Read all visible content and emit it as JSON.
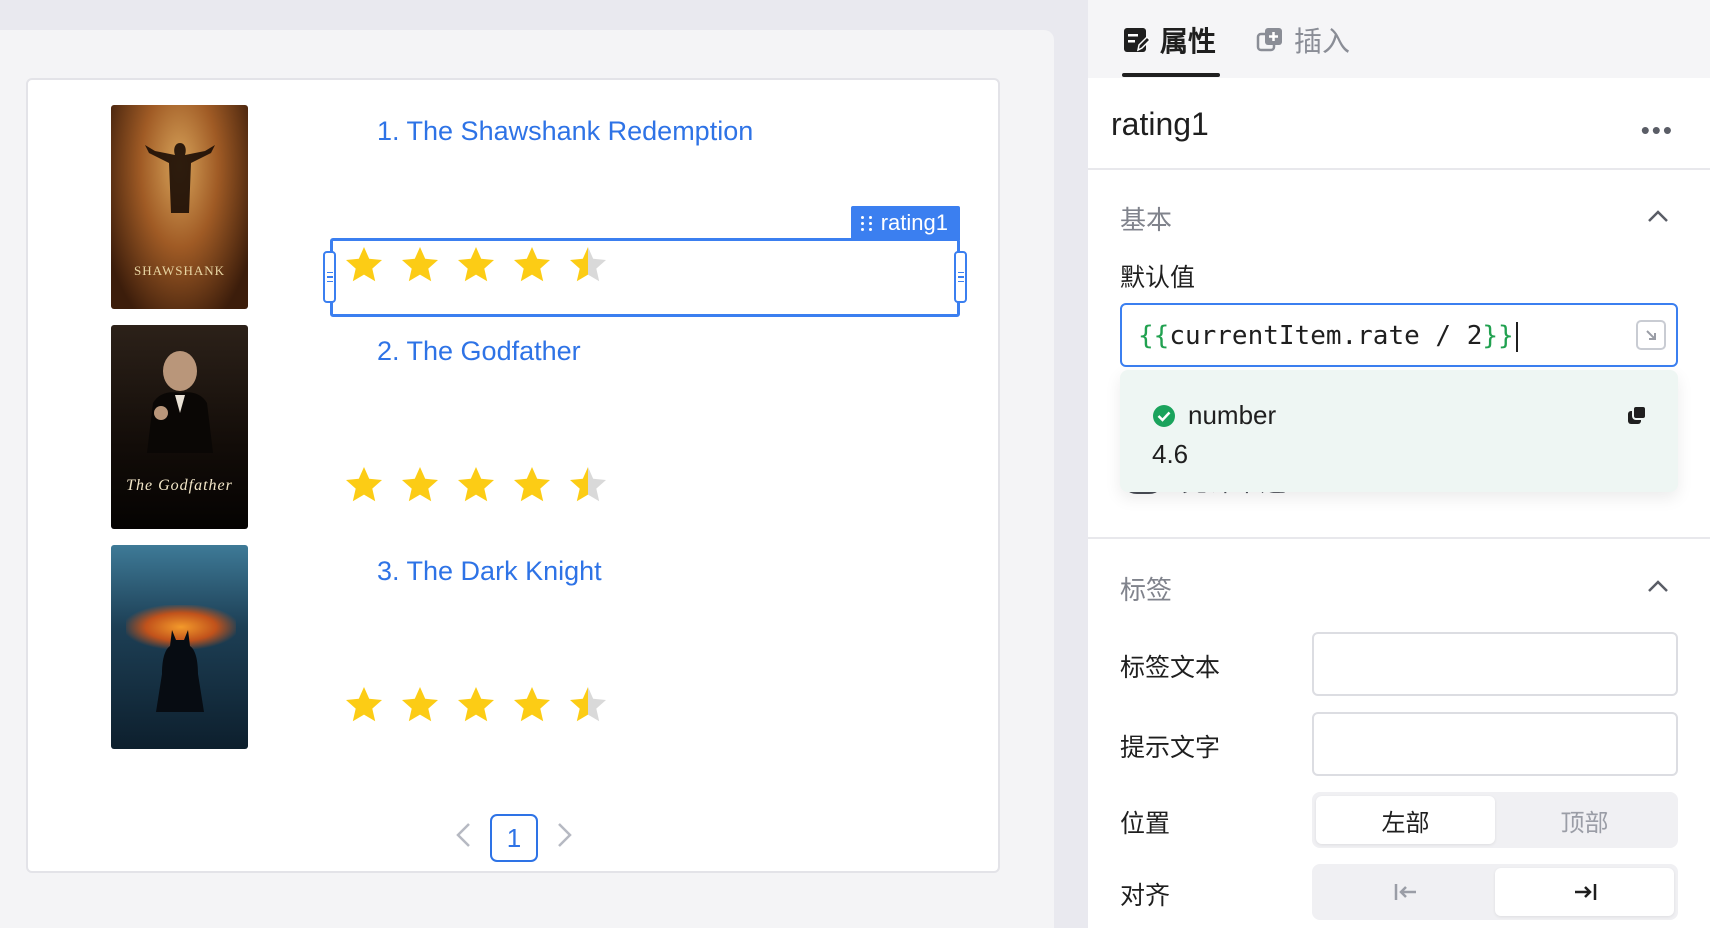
{
  "list": {
    "items": [
      {
        "title": "1. The Shawshank Redemption",
        "rating": 4.6,
        "poster_caption": "SHAWSHANK"
      },
      {
        "title": "2. The Godfather",
        "rating": 4.6,
        "poster_caption": "The Godfather"
      },
      {
        "title": "3. The Dark Knight",
        "rating": 4.6,
        "poster_caption": ""
      }
    ],
    "max_stars": 5,
    "selected_component": "rating1",
    "pagination": {
      "current_page": "1",
      "prev_icon": "chevron-left-icon",
      "next_icon": "chevron-right-icon"
    }
  },
  "panel": {
    "tabs": [
      {
        "label": "属性",
        "icon": "edit-properties-icon",
        "active": true
      },
      {
        "label": "插入",
        "icon": "insert-component-icon",
        "active": false
      }
    ],
    "component_name": "rating1",
    "more_label": "•••",
    "sections": {
      "basic": {
        "title": "基本",
        "default_value_label": "默认值",
        "expression_open": "{{",
        "expression_body": "currentItem.rate / 2",
        "expression_close": "}}",
        "hint": {
          "type": "number",
          "value": "4.6"
        },
        "obscured_row_text": "允许半选"
      },
      "label": {
        "title": "标签",
        "label_text_label": "标签文本",
        "label_text_value": "",
        "hint_text_label": "提示文字",
        "hint_text_value": "",
        "position_label": "位置",
        "position_options": [
          "左部",
          "顶部"
        ],
        "position_selected": "左部",
        "align_label": "对齐",
        "align_options": [
          "align-left-icon",
          "align-right-icon"
        ],
        "align_selected": "align-right-icon"
      }
    }
  },
  "colors": {
    "accent": "#3b7ff0",
    "link": "#2e73e6",
    "star_filled": "#fccc15",
    "star_empty": "#d9d9d9",
    "success": "#1aa35c"
  }
}
